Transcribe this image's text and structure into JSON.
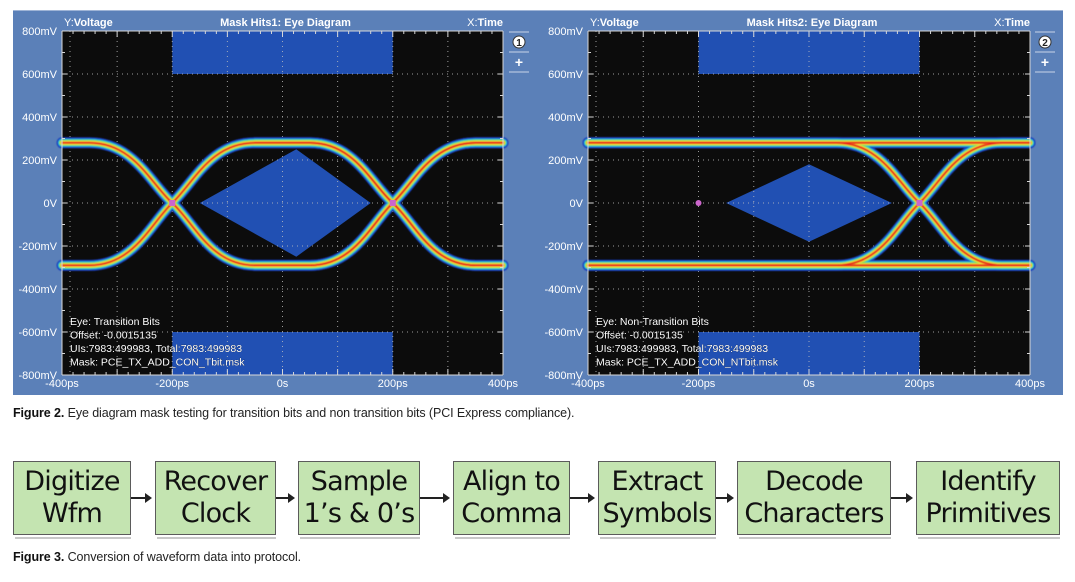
{
  "figure2": {
    "caption_label": "Figure 2.",
    "caption_text": " Eye diagram mask testing for transition bits and non transition bits (PCI Express compliance).",
    "colors": {
      "panel": "#5b80b8",
      "plot_bg": "#0c0c0c",
      "mask": "#2150b3",
      "grid": "#bfbfbf",
      "crossing_marker": "#cc66cc"
    }
  },
  "chart_data": [
    {
      "type": "eye-diagram",
      "id": 1,
      "title": "Mask Hits1: Eye Diagram",
      "ylabel_prefix": "Y:",
      "ylabel": "Voltage",
      "xlabel_prefix": "X:",
      "xlabel": "Time",
      "badge": "1",
      "add_button": "+",
      "ylim_mV": [
        -800,
        800
      ],
      "xlim_ps": [
        -400,
        400
      ],
      "yticks": [
        "800mV",
        "600mV",
        "400mV",
        "200mV",
        "0V",
        "-200mV",
        "-400mV",
        "-600mV",
        "-800mV"
      ],
      "ytick_values_mV": [
        800,
        600,
        400,
        200,
        0,
        -200,
        -400,
        -600,
        -800
      ],
      "xticks": [
        "-400ps",
        "-200ps",
        "0s",
        "200ps",
        "400ps"
      ],
      "xtick_values_ps": [
        -400,
        -200,
        0,
        200,
        400
      ],
      "grid": true,
      "signal_levels_mV": [
        280,
        -290
      ],
      "crossings_ps": [
        -200,
        200
      ],
      "masks": [
        {
          "name": "top-mask",
          "x_ps": [
            -200,
            200
          ],
          "y_mV": [
            600,
            800
          ]
        },
        {
          "name": "bottom-mask",
          "x_ps": [
            -200,
            200
          ],
          "y_mV": [
            -800,
            -600
          ]
        },
        {
          "name": "center-diamond",
          "points_ps_mV": [
            [
              -150,
              0
            ],
            [
              25,
              250
            ],
            [
              160,
              0
            ],
            [
              25,
              -250
            ]
          ]
        }
      ],
      "annotations": [
        "Eye: Transition Bits",
        "Offset: -0.0015135",
        "UIs:7983:499983, Total:7983:499983",
        "Mask: PCE_TX_ADD_CON_Tbit.msk"
      ],
      "transition_style": "transition"
    },
    {
      "type": "eye-diagram",
      "id": 2,
      "title": "Mask Hits2: Eye Diagram",
      "ylabel_prefix": "Y:",
      "ylabel": "Voltage",
      "xlabel_prefix": "X:",
      "xlabel": "Time",
      "badge": "2",
      "add_button": "+",
      "ylim_mV": [
        -800,
        800
      ],
      "xlim_ps": [
        -400,
        400
      ],
      "yticks": [
        "800mV",
        "600mV",
        "400mV",
        "200mV",
        "0V",
        "-200mV",
        "-400mV",
        "-600mV",
        "-800mV"
      ],
      "ytick_values_mV": [
        800,
        600,
        400,
        200,
        0,
        -200,
        -400,
        -600,
        -800
      ],
      "xticks": [
        "-400ps",
        "-200ps",
        "0s",
        "200ps",
        "400ps"
      ],
      "xtick_values_ps": [
        -400,
        -200,
        0,
        200,
        400
      ],
      "grid": true,
      "signal_levels_mV": [
        280,
        -290
      ],
      "crossings_ps": [
        200
      ],
      "isolated_marker_ps": [
        -200
      ],
      "masks": [
        {
          "name": "top-mask",
          "x_ps": [
            -200,
            200
          ],
          "y_mV": [
            600,
            800
          ]
        },
        {
          "name": "bottom-mask",
          "x_ps": [
            -200,
            200
          ],
          "y_mV": [
            -800,
            -600
          ]
        },
        {
          "name": "center-diamond",
          "points_ps_mV": [
            [
              -150,
              0
            ],
            [
              0,
              180
            ],
            [
              150,
              0
            ],
            [
              0,
              -180
            ]
          ]
        }
      ],
      "annotations": [
        "Eye: Non-Transition Bits",
        "Offset: -0.0015135",
        "UIs:7983:499983, Total:7983:499983",
        "Mask: PCE_TX_ADD_CON_NTbit.msk"
      ],
      "transition_style": "non-transition"
    }
  ],
  "figure3": {
    "caption_label": "Figure 3.",
    "caption_text": " Conversion of waveform data into protocol.",
    "box_color": "#c4e4b1",
    "steps": [
      {
        "line1": "Digitize",
        "line2": "Wfm"
      },
      {
        "line1": "Recover",
        "line2": "Clock"
      },
      {
        "line1": "Sample",
        "line2": "1’s & 0’s"
      },
      {
        "line1": "Align to",
        "line2": "Comma"
      },
      {
        "line1": "Extract",
        "line2": "Symbols"
      },
      {
        "line1": "Decode",
        "line2": "Characters"
      },
      {
        "line1": "Identify",
        "line2": "Primitives"
      }
    ]
  }
}
